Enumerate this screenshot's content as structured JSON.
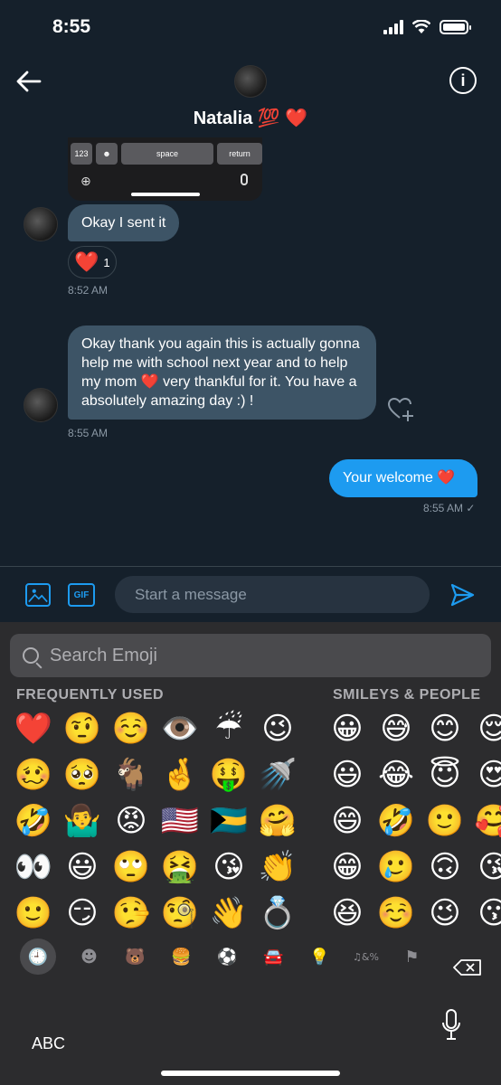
{
  "status_bar": {
    "time": "8:55"
  },
  "header": {
    "name": "Natalia",
    "name_emojis": "💯 ❤️"
  },
  "shared_image": {
    "keys": [
      "123",
      "☻",
      "space",
      "return"
    ]
  },
  "messages": {
    "m1": {
      "text": "Okay I sent it",
      "time": "8:52 AM",
      "reaction_emoji": "❤️",
      "reaction_count": "1"
    },
    "m2": {
      "text": "Okay thank you again this is actually gonna help me with school next year and to help my mom ❤️ very thankful for it. You have a absolutely amazing day :) !",
      "time": "8:55 AM"
    },
    "m3": {
      "text": "Your welcome ❤️",
      "time": "8:55 AM ✓"
    }
  },
  "composer": {
    "gif_label": "GIF",
    "placeholder": "Start a message"
  },
  "emoji_keyboard": {
    "search_placeholder": "Search Emoji",
    "section_frequent": "FREQUENTLY USED",
    "section_smileys": "SMILEYS & PEOPLE",
    "frequent": [
      "❤️",
      "🤨",
      "☺️",
      "👁️",
      "☔",
      "😉",
      "🥴",
      "🥺",
      "🐐",
      "🤞",
      "🤑",
      "🚿",
      "🤣",
      "🤷‍♂️",
      "😡",
      "🇺🇸",
      "🇧🇸",
      "🤗",
      "👀",
      "😃",
      "🙄",
      "🤮",
      "😘",
      "👏",
      "🙂",
      "😏",
      "🤥",
      "🧐",
      "👋",
      "💍"
    ],
    "smileys": [
      "😀",
      "😅",
      "😊",
      "😌",
      "😃",
      "😂",
      "😇",
      "😍",
      "😄",
      "🤣",
      "🙂",
      "🥰",
      "😁",
      "🥲",
      "🙃",
      "😘",
      "😆",
      "☺️",
      "😉",
      "😗"
    ],
    "categories": [
      "🕘",
      "☻",
      "🐻",
      "🍔",
      "⚽",
      "🚘",
      "💡",
      "♫&%",
      "⚑"
    ],
    "abc_label": "ABC"
  },
  "colors": {
    "accent": "#1d9bf0",
    "background": "#15202b",
    "incoming_bubble": "#3d5466"
  }
}
